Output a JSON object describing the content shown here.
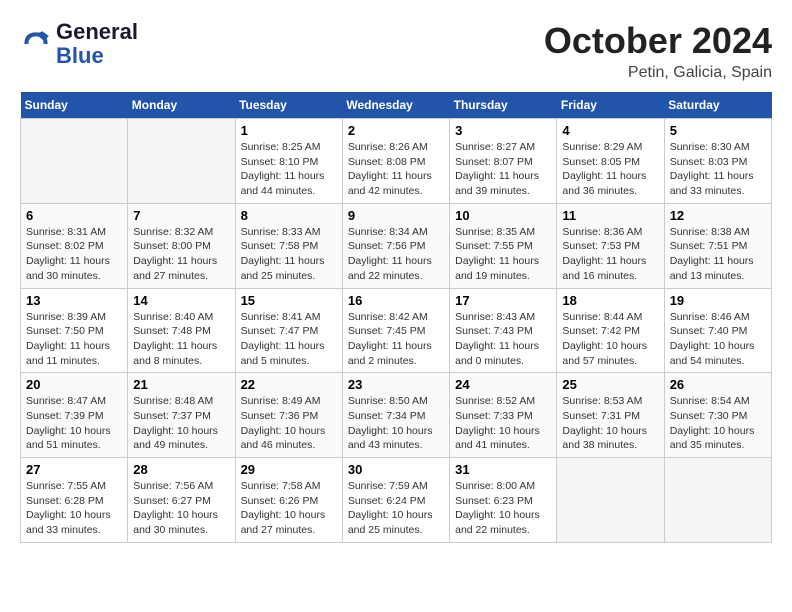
{
  "header": {
    "logo_line1": "General",
    "logo_line2": "Blue",
    "month": "October 2024",
    "location": "Petin, Galicia, Spain"
  },
  "weekdays": [
    "Sunday",
    "Monday",
    "Tuesday",
    "Wednesday",
    "Thursday",
    "Friday",
    "Saturday"
  ],
  "weeks": [
    [
      {
        "day": "",
        "info": ""
      },
      {
        "day": "",
        "info": ""
      },
      {
        "day": "1",
        "info": "Sunrise: 8:25 AM\nSunset: 8:10 PM\nDaylight: 11 hours and 44 minutes."
      },
      {
        "day": "2",
        "info": "Sunrise: 8:26 AM\nSunset: 8:08 PM\nDaylight: 11 hours and 42 minutes."
      },
      {
        "day": "3",
        "info": "Sunrise: 8:27 AM\nSunset: 8:07 PM\nDaylight: 11 hours and 39 minutes."
      },
      {
        "day": "4",
        "info": "Sunrise: 8:29 AM\nSunset: 8:05 PM\nDaylight: 11 hours and 36 minutes."
      },
      {
        "day": "5",
        "info": "Sunrise: 8:30 AM\nSunset: 8:03 PM\nDaylight: 11 hours and 33 minutes."
      }
    ],
    [
      {
        "day": "6",
        "info": "Sunrise: 8:31 AM\nSunset: 8:02 PM\nDaylight: 11 hours and 30 minutes."
      },
      {
        "day": "7",
        "info": "Sunrise: 8:32 AM\nSunset: 8:00 PM\nDaylight: 11 hours and 27 minutes."
      },
      {
        "day": "8",
        "info": "Sunrise: 8:33 AM\nSunset: 7:58 PM\nDaylight: 11 hours and 25 minutes."
      },
      {
        "day": "9",
        "info": "Sunrise: 8:34 AM\nSunset: 7:56 PM\nDaylight: 11 hours and 22 minutes."
      },
      {
        "day": "10",
        "info": "Sunrise: 8:35 AM\nSunset: 7:55 PM\nDaylight: 11 hours and 19 minutes."
      },
      {
        "day": "11",
        "info": "Sunrise: 8:36 AM\nSunset: 7:53 PM\nDaylight: 11 hours and 16 minutes."
      },
      {
        "day": "12",
        "info": "Sunrise: 8:38 AM\nSunset: 7:51 PM\nDaylight: 11 hours and 13 minutes."
      }
    ],
    [
      {
        "day": "13",
        "info": "Sunrise: 8:39 AM\nSunset: 7:50 PM\nDaylight: 11 hours and 11 minutes."
      },
      {
        "day": "14",
        "info": "Sunrise: 8:40 AM\nSunset: 7:48 PM\nDaylight: 11 hours and 8 minutes."
      },
      {
        "day": "15",
        "info": "Sunrise: 8:41 AM\nSunset: 7:47 PM\nDaylight: 11 hours and 5 minutes."
      },
      {
        "day": "16",
        "info": "Sunrise: 8:42 AM\nSunset: 7:45 PM\nDaylight: 11 hours and 2 minutes."
      },
      {
        "day": "17",
        "info": "Sunrise: 8:43 AM\nSunset: 7:43 PM\nDaylight: 11 hours and 0 minutes."
      },
      {
        "day": "18",
        "info": "Sunrise: 8:44 AM\nSunset: 7:42 PM\nDaylight: 10 hours and 57 minutes."
      },
      {
        "day": "19",
        "info": "Sunrise: 8:46 AM\nSunset: 7:40 PM\nDaylight: 10 hours and 54 minutes."
      }
    ],
    [
      {
        "day": "20",
        "info": "Sunrise: 8:47 AM\nSunset: 7:39 PM\nDaylight: 10 hours and 51 minutes."
      },
      {
        "day": "21",
        "info": "Sunrise: 8:48 AM\nSunset: 7:37 PM\nDaylight: 10 hours and 49 minutes."
      },
      {
        "day": "22",
        "info": "Sunrise: 8:49 AM\nSunset: 7:36 PM\nDaylight: 10 hours and 46 minutes."
      },
      {
        "day": "23",
        "info": "Sunrise: 8:50 AM\nSunset: 7:34 PM\nDaylight: 10 hours and 43 minutes."
      },
      {
        "day": "24",
        "info": "Sunrise: 8:52 AM\nSunset: 7:33 PM\nDaylight: 10 hours and 41 minutes."
      },
      {
        "day": "25",
        "info": "Sunrise: 8:53 AM\nSunset: 7:31 PM\nDaylight: 10 hours and 38 minutes."
      },
      {
        "day": "26",
        "info": "Sunrise: 8:54 AM\nSunset: 7:30 PM\nDaylight: 10 hours and 35 minutes."
      }
    ],
    [
      {
        "day": "27",
        "info": "Sunrise: 7:55 AM\nSunset: 6:28 PM\nDaylight: 10 hours and 33 minutes."
      },
      {
        "day": "28",
        "info": "Sunrise: 7:56 AM\nSunset: 6:27 PM\nDaylight: 10 hours and 30 minutes."
      },
      {
        "day": "29",
        "info": "Sunrise: 7:58 AM\nSunset: 6:26 PM\nDaylight: 10 hours and 27 minutes."
      },
      {
        "day": "30",
        "info": "Sunrise: 7:59 AM\nSunset: 6:24 PM\nDaylight: 10 hours and 25 minutes."
      },
      {
        "day": "31",
        "info": "Sunrise: 8:00 AM\nSunset: 6:23 PM\nDaylight: 10 hours and 22 minutes."
      },
      {
        "day": "",
        "info": ""
      },
      {
        "day": "",
        "info": ""
      }
    ]
  ]
}
